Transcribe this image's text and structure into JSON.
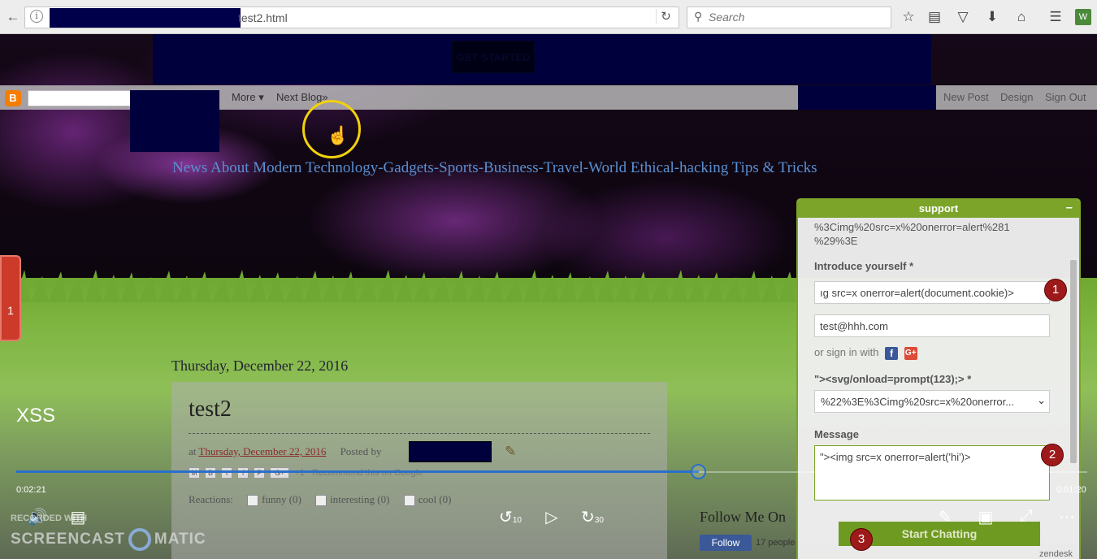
{
  "browser": {
    "url_suffix": "test2.html",
    "search_placeholder": "Search"
  },
  "banner": {
    "get_started": "GET STARTED"
  },
  "navbar": {
    "more": "More ▾",
    "next_blog": "Next Blog»",
    "new_post": "New Post",
    "design": "Design",
    "sign_out": "Sign Out"
  },
  "blog": {
    "description": "News About Modern Technology-Gadgets-Sports-Business-Travel-World Ethical-hacking Tips & Tricks",
    "date_header": "Thursday, December 22, 2016",
    "post_title": "test2",
    "meta_at": "at",
    "meta_date": "Thursday, December 22, 2016",
    "meta_posted_by": "Posted by",
    "share_plus": "+1",
    "recommend": "Recommend this on Google",
    "reactions_label": "Reactions:",
    "reactions": [
      "funny (0)",
      "interesting (0)",
      "cool (0)"
    ],
    "follow_title": "Follow Me On",
    "follow_button": "Follow",
    "follow_count": "17 people"
  },
  "chat": {
    "title": "support",
    "prev_text_line1": "%3Cimg%20src=x%20onerror=alert%281",
    "prev_text_line2": "%29%3E",
    "name_label": "Introduce yourself *",
    "name_value": "ıg src=x onerror=alert(document.cookie)>",
    "email_value": "test@hhh.com",
    "signin_text": "or sign in with",
    "dept_label": "\"><svg/onload=prompt(123);> *",
    "dept_value": "%22%3E%3Cimg%20src=x%20onerror...",
    "message_label": "Message",
    "message_value": "\"><img src=x onerror=alert('hi')>",
    "start_button": "Start Chatting",
    "footer": "zendesk"
  },
  "annotations": {
    "badge1": "1",
    "badge2": "2",
    "badge3": "3"
  },
  "player": {
    "title": "XSS",
    "elapsed": "0:02:21",
    "remaining": "0:01:20",
    "progress_fraction": 0.637,
    "rewind_label": "10",
    "forward_label": "30",
    "watermark_small": "RECORDED WITH",
    "watermark_left": "SCREENCAST",
    "watermark_right": "MATIC"
  }
}
